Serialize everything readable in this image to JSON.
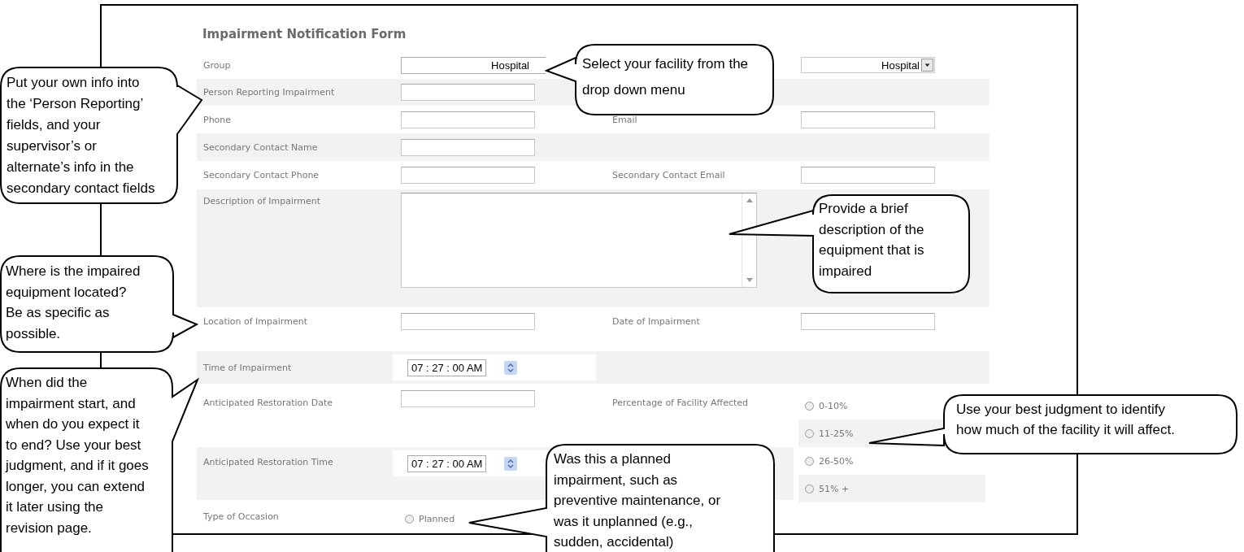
{
  "form": {
    "title": "Impairment Notification Form",
    "rows": [
      {
        "kind": "pair",
        "shaded": false,
        "label": "Group",
        "field": {
          "kind": "select",
          "value": "Hospital"
        },
        "field2": {
          "kind": "dropdown",
          "value": "Hospital"
        }
      },
      {
        "kind": "pair",
        "shaded": true,
        "label": "Person Reporting Impairment",
        "field": {
          "kind": "text"
        }
      },
      {
        "kind": "pair",
        "shaded": false,
        "label": "Phone",
        "field": {
          "kind": "text"
        },
        "label2": "Email",
        "field2": {
          "kind": "text"
        }
      },
      {
        "kind": "pair",
        "shaded": true,
        "label": "Secondary Contact Name",
        "field": {
          "kind": "text"
        }
      },
      {
        "kind": "pair",
        "shaded": false,
        "label": "Secondary Contact Phone",
        "field": {
          "kind": "text"
        },
        "label2": "Secondary Contact Email",
        "field2": {
          "kind": "text"
        }
      },
      {
        "kind": "textarea",
        "shaded": true,
        "label": "Description of Impairment"
      },
      {
        "kind": "pair",
        "shaded": false,
        "label": "Location of Impairment",
        "field": {
          "kind": "text"
        },
        "label2": "Date of Impairment",
        "field2": {
          "kind": "text"
        }
      },
      {
        "kind": "pair",
        "shaded": true,
        "label": "Time of Impairment",
        "field": {
          "kind": "time",
          "value": "07 : 27 : 00 AM"
        }
      },
      {
        "kind": "split",
        "date_label": "Anticipated Restoration Date",
        "time_label": "Anticipated Restoration Time",
        "time_value": "07 : 27 : 00 AM",
        "percent_label": "Percentage of Facility Affected",
        "options": [
          {
            "label": "0-10%",
            "selected": false,
            "shaded": false
          },
          {
            "label": "11-25%",
            "selected": false,
            "shaded": true
          },
          {
            "label": "26-50%",
            "selected": false,
            "shaded": false
          },
          {
            "label": "51% +",
            "selected": false,
            "shaded": true
          }
        ]
      },
      {
        "kind": "radio",
        "shaded": false,
        "label": "Type of Occasion",
        "options": [
          {
            "label": "Planned",
            "selected": false
          }
        ]
      }
    ]
  },
  "callouts": [
    {
      "text": "Put your own info into the ‘Person Reporting’ fields, and your supervisor’s or alternate’s info in the secondary contact fields"
    },
    {
      "text": "Select your facility from the drop down menu"
    },
    {
      "text": "Provide a brief description of the equipment that is impaired"
    },
    {
      "text": "Where is the impaired equipment located? Be as specific as possible."
    },
    {
      "text": "When did the impairment start, and when do you expect it to end? Use your best judgment, and if it goes longer, you can extend it later using the revision page."
    },
    {
      "text": "Use your best judgment to identify how much of the facility it will affect."
    },
    {
      "text": "Was this a planned impairment, such as preventive maintenance, or was it unplanned (e.g., sudden, accidental)"
    }
  ]
}
